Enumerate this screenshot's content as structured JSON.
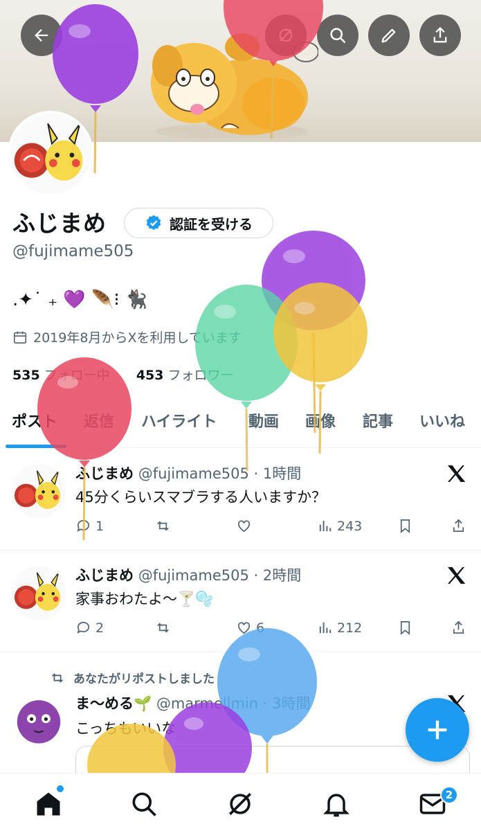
{
  "header": {
    "back_icon": "arrow-left-icon",
    "grok_icon": "grok-icon",
    "search_icon": "search-icon",
    "edit_icon": "pencil-icon",
    "share_icon": "share-icon"
  },
  "profile": {
    "name": "ふじまめ",
    "verify_label": "認証を受ける",
    "handle": "@fujimame505",
    "bio": ".✦˙ ₊ 💜 🪶⁝ 🐈‍⬛",
    "joined": "2019年8月からXを利用しています",
    "following_count": "535",
    "following_label": "フォロー中",
    "followers_count": "453",
    "followers_label": "フォロワー"
  },
  "tabs": [
    "ポスト",
    "返信",
    "ハイライト",
    "動画",
    "画像",
    "記事",
    "いいね"
  ],
  "tweets": [
    {
      "name": "ふじまめ",
      "meta": "@fujimame505 · 1時間",
      "text": "45分くらいスマブラする人いますか？",
      "replies": "1",
      "reposts": "",
      "likes": "",
      "views": "243"
    },
    {
      "name": "ふじまめ",
      "meta": "@fujimame505 · 2時間",
      "text": "家事おわたよ〜🍸🫧",
      "replies": "2",
      "reposts": "",
      "likes": "6",
      "views": "212"
    },
    {
      "repost_note": "あなたがリポストしました",
      "name": "ま〜める🌱",
      "meta": "@marmellmin · 3時間",
      "text": "こっちもいいな"
    }
  ],
  "nav": {
    "items": [
      "home-icon",
      "search-icon",
      "grok-icon",
      "bell-icon",
      "mail-icon"
    ],
    "mail_badge": "2"
  },
  "colors": {
    "accent": "#1d9bf0",
    "text": "#0f1419",
    "secondary": "#536471"
  }
}
